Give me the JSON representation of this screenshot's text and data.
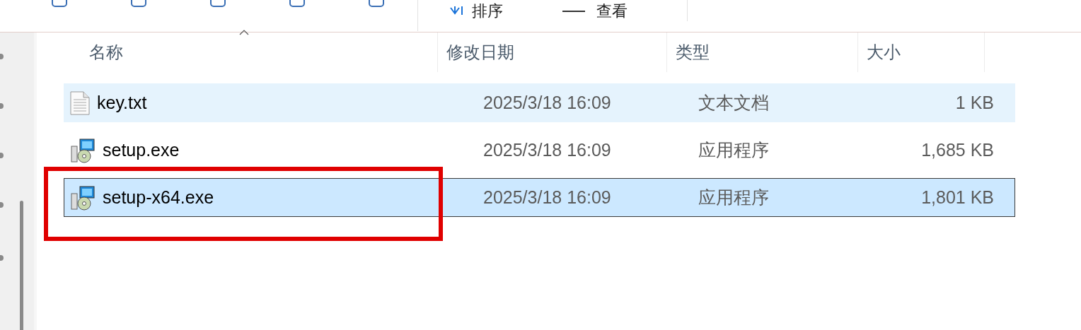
{
  "toolbar": {
    "sort_button": {
      "label": "排序"
    },
    "view_button": {
      "label": "查看"
    }
  },
  "columns": [
    {
      "label": "名称",
      "sorted": true
    },
    {
      "label": "修改日期",
      "sorted": false
    },
    {
      "label": "类型",
      "sorted": false
    },
    {
      "label": "大小",
      "sorted": false
    }
  ],
  "files": [
    {
      "name": "key.txt",
      "modified": "2025/3/18 16:09",
      "type": "文本文档",
      "size": "1 KB",
      "kind": "text",
      "selected": false,
      "hovered": true,
      "highlighted": false
    },
    {
      "name": "setup.exe",
      "modified": "2025/3/18 16:09",
      "type": "应用程序",
      "size": "1,685 KB",
      "kind": "installer",
      "selected": false,
      "hovered": false,
      "highlighted": false
    },
    {
      "name": "setup-x64.exe",
      "modified": "2025/3/18 16:09",
      "type": "应用程序",
      "size": "1,801 KB",
      "kind": "installer",
      "selected": true,
      "hovered": false,
      "highlighted": true
    }
  ]
}
